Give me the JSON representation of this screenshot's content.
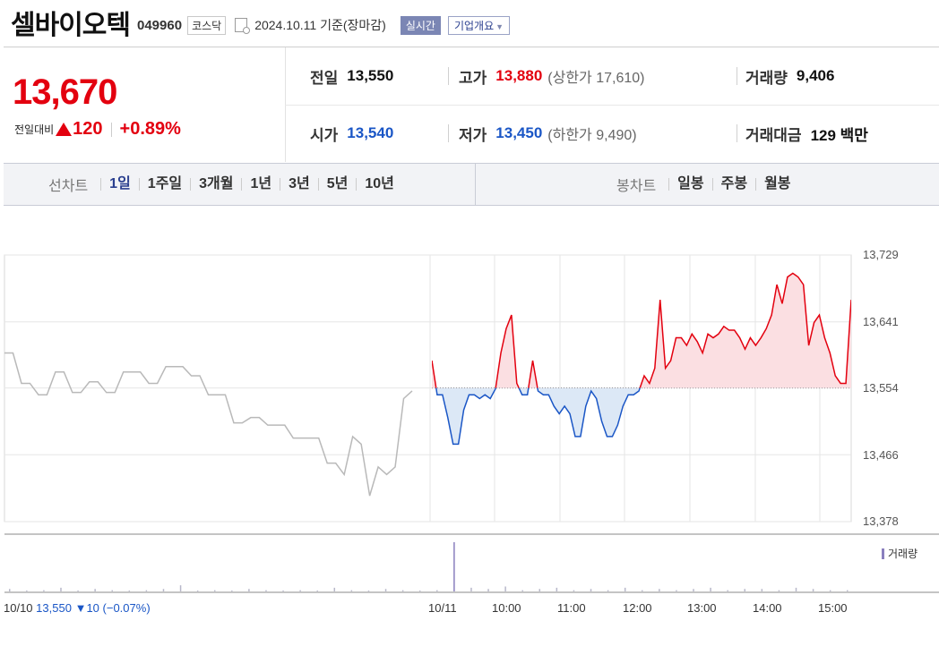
{
  "header": {
    "stock_name": "셀바이오텍",
    "stock_code": "049960",
    "market": "코스닥",
    "date_text": "2024.10.11 기준(장마감)",
    "live_button": "실시간",
    "company_button": "기업개요"
  },
  "quote": {
    "price": "13,670",
    "change_label": "전일대비",
    "change_value": "120",
    "change_pct": "+0.89%",
    "prev_label": "전일",
    "prev_value": "13,550",
    "high_label": "고가",
    "high_value": "13,880",
    "upper_limit": "(상한가 17,610)",
    "volume_label": "거래량",
    "volume_value": "9,406",
    "open_label": "시가",
    "open_value": "13,540",
    "low_label": "저가",
    "low_value": "13,450",
    "lower_limit": "(하한가 9,490)",
    "amount_label": "거래대금",
    "amount_value": "129 백만"
  },
  "tabs": {
    "line_label": "선차트",
    "line_items": [
      "1일",
      "1주일",
      "3개월",
      "1년",
      "3년",
      "5년",
      "10년"
    ],
    "line_active": "1일",
    "candle_label": "봉차트",
    "candle_items": [
      "일봉",
      "주봉",
      "월봉"
    ]
  },
  "colors": {
    "up": "#e3000f",
    "down": "#1a56c6",
    "prev_day_line": "#b9b9b9",
    "volume_bar": "#8a7fbe"
  },
  "chart_data": {
    "type": "line",
    "y_ticks": [
      "13,729",
      "13,641",
      "13,554",
      "13,466",
      "13,378"
    ],
    "ylim": [
      13378,
      13729
    ],
    "baseline": 13554,
    "x_ticks": [
      "10/10",
      "10/11",
      "10:00",
      "11:00",
      "12:00",
      "13:00",
      "14:00",
      "15:00"
    ],
    "prev_day_summary": {
      "close": "13,550",
      "change": "10",
      "change_pct": "(−0.07%)"
    },
    "volume_legend": "거래량",
    "series": [
      {
        "period": "10/10",
        "values": [
          13600,
          13600,
          13560,
          13560,
          13545,
          13545,
          13575,
          13575,
          13548,
          13548,
          13562,
          13562,
          13548,
          13548,
          13575,
          13575,
          13575,
          13560,
          13560,
          13582,
          13582,
          13582,
          13570,
          13570,
          13545,
          13545,
          13545,
          13508,
          13508,
          13515,
          13515,
          13505,
          13505,
          13505,
          13488,
          13488,
          13488,
          13488,
          13455,
          13455,
          13440,
          13490,
          13480,
          13412,
          13450,
          13440,
          13450,
          13540,
          13550
        ]
      },
      {
        "period": "10/11",
        "values": [
          13590,
          13545,
          13545,
          13515,
          13480,
          13480,
          13525,
          13545,
          13545,
          13540,
          13545,
          13540,
          13553,
          13600,
          13632,
          13650,
          13560,
          13545,
          13545,
          13590,
          13550,
          13545,
          13545,
          13530,
          13520,
          13530,
          13520,
          13490,
          13490,
          13530,
          13550,
          13540,
          13510,
          13490,
          13490,
          13505,
          13530,
          13545,
          13545,
          13550,
          13570,
          13560,
          13580,
          13670,
          13580,
          13590,
          13620,
          13620,
          13610,
          13625,
          13615,
          13600,
          13625,
          13620,
          13625,
          13635,
          13630,
          13630,
          13620,
          13605,
          13620,
          13610,
          13620,
          13632,
          13650,
          13690,
          13665,
          13700,
          13705,
          13700,
          13690,
          13610,
          13640,
          13650,
          13620,
          13600,
          13570,
          13560,
          13560,
          13670
        ]
      }
    ],
    "volume": [
      2,
      0,
      1,
      3,
      0,
      2,
      1,
      0,
      1,
      2,
      5,
      0,
      1,
      0,
      2,
      1,
      0,
      1,
      0,
      3,
      1,
      0,
      2,
      1,
      0,
      1,
      40,
      3,
      2,
      4,
      1,
      2,
      3,
      1,
      2,
      1,
      3,
      1,
      2,
      1,
      2,
      3,
      1,
      2,
      2,
      1,
      3,
      2,
      1,
      1
    ]
  }
}
